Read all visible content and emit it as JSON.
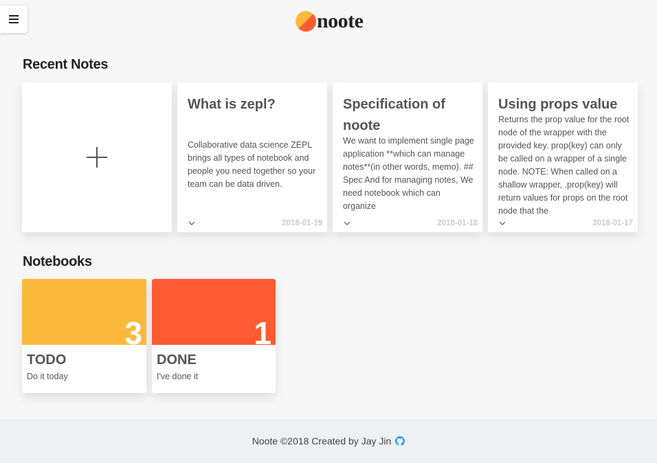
{
  "app": {
    "logo_text": "noote",
    "logo_colors": [
      "#fbb93c",
      "#ff5b33"
    ]
  },
  "header": {
    "menu_icon": "hamburger-icon"
  },
  "recent": {
    "title": "Recent Notes",
    "add_icon": "plus-icon",
    "notes": [
      {
        "title": "What is zepl?",
        "body": "Collaborative data science ZEPL brings all types of notebook and people you need together so your team can be data driven.",
        "date": "2018-01-19"
      },
      {
        "title": "Specification of noote",
        "body": "We want to implement single page application **which can manage notes**(in other words, memo). ## Spec And for managing notes, We need notebook which can organize",
        "date": "2018-01-18"
      },
      {
        "title": "Using props value",
        "body": "Returns the prop value for the root node of the wrapper with the provided key. prop(key) can only be called on a wrapper of a single node. NOTE: When called on a shallow wrapper, .prop(key) will return values for props on the root node that the",
        "date": "2018-01-17"
      }
    ]
  },
  "notebooks": {
    "title": "Notebooks",
    "items": [
      {
        "name": "TODO",
        "desc": "Do it today",
        "count": "3",
        "color": "#fbb93c"
      },
      {
        "name": "DONE",
        "desc": "I've done it",
        "count": "1",
        "color": "#ff5b33"
      }
    ]
  },
  "footer": {
    "text": "Noote ©2018 Created by Jay Jin",
    "icon": "github-icon",
    "icon_color": "#1ba1f2"
  }
}
